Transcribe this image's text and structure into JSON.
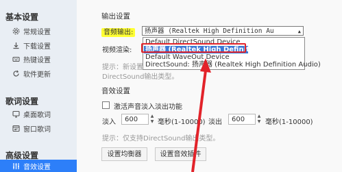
{
  "sidebar": {
    "basic_settings": "基本设置",
    "items_basic": [
      {
        "label": "常规设置",
        "icon": "gear-icon"
      },
      {
        "label": "下载设置",
        "icon": "download-icon"
      },
      {
        "label": "热键设置",
        "icon": "keyboard-icon"
      },
      {
        "label": "软件更新",
        "icon": "update-icon"
      }
    ],
    "lyrics_settings": "歌词设置",
    "items_lyrics": [
      {
        "label": "桌面歌词",
        "icon": "desktop-lyrics-icon"
      },
      {
        "label": "窗口歌词",
        "icon": "window-lyrics-icon"
      }
    ],
    "advanced_settings": "高级设置",
    "items_advanced": [
      {
        "label": "音效设置",
        "icon": "equalizer-icon",
        "active": true
      }
    ]
  },
  "output": {
    "section_title": "输出设置",
    "device_label": "音频输出:",
    "selected_value": "扬声器 (Realtek High Definition Au",
    "video_render_label": "视频渲染:",
    "hint_text_part1": "提示：新设置",
    "hint_text_part2": "DirectSound输出类型。",
    "dropdown_options": [
      "Default DirectSound Device",
      "扬声器 (Realtek High Definition Au",
      "Default WaveOut Device",
      "DirectSound: 扬声器 (Realtek High Definition Audio)"
    ]
  },
  "effects": {
    "section_title": "音效设置",
    "fade_checkbox_label": "激活声音淡入淡出功能",
    "fade_in_label": "淡入",
    "fade_in_value": "600",
    "fade_in_unit": "毫秒(1-10000)",
    "fade_out_label": "淡出",
    "fade_out_value": "600",
    "fade_out_unit": "毫秒(1-10000)",
    "hint": "提示：仅支持DirectSound输出类型。",
    "equalizer_button": "设置均衡器",
    "plugin_button": "设置音效插件"
  },
  "colors": {
    "accent": "#2d7ff9",
    "highlight": "#ffff33",
    "annotation_red": "#e2232a"
  }
}
